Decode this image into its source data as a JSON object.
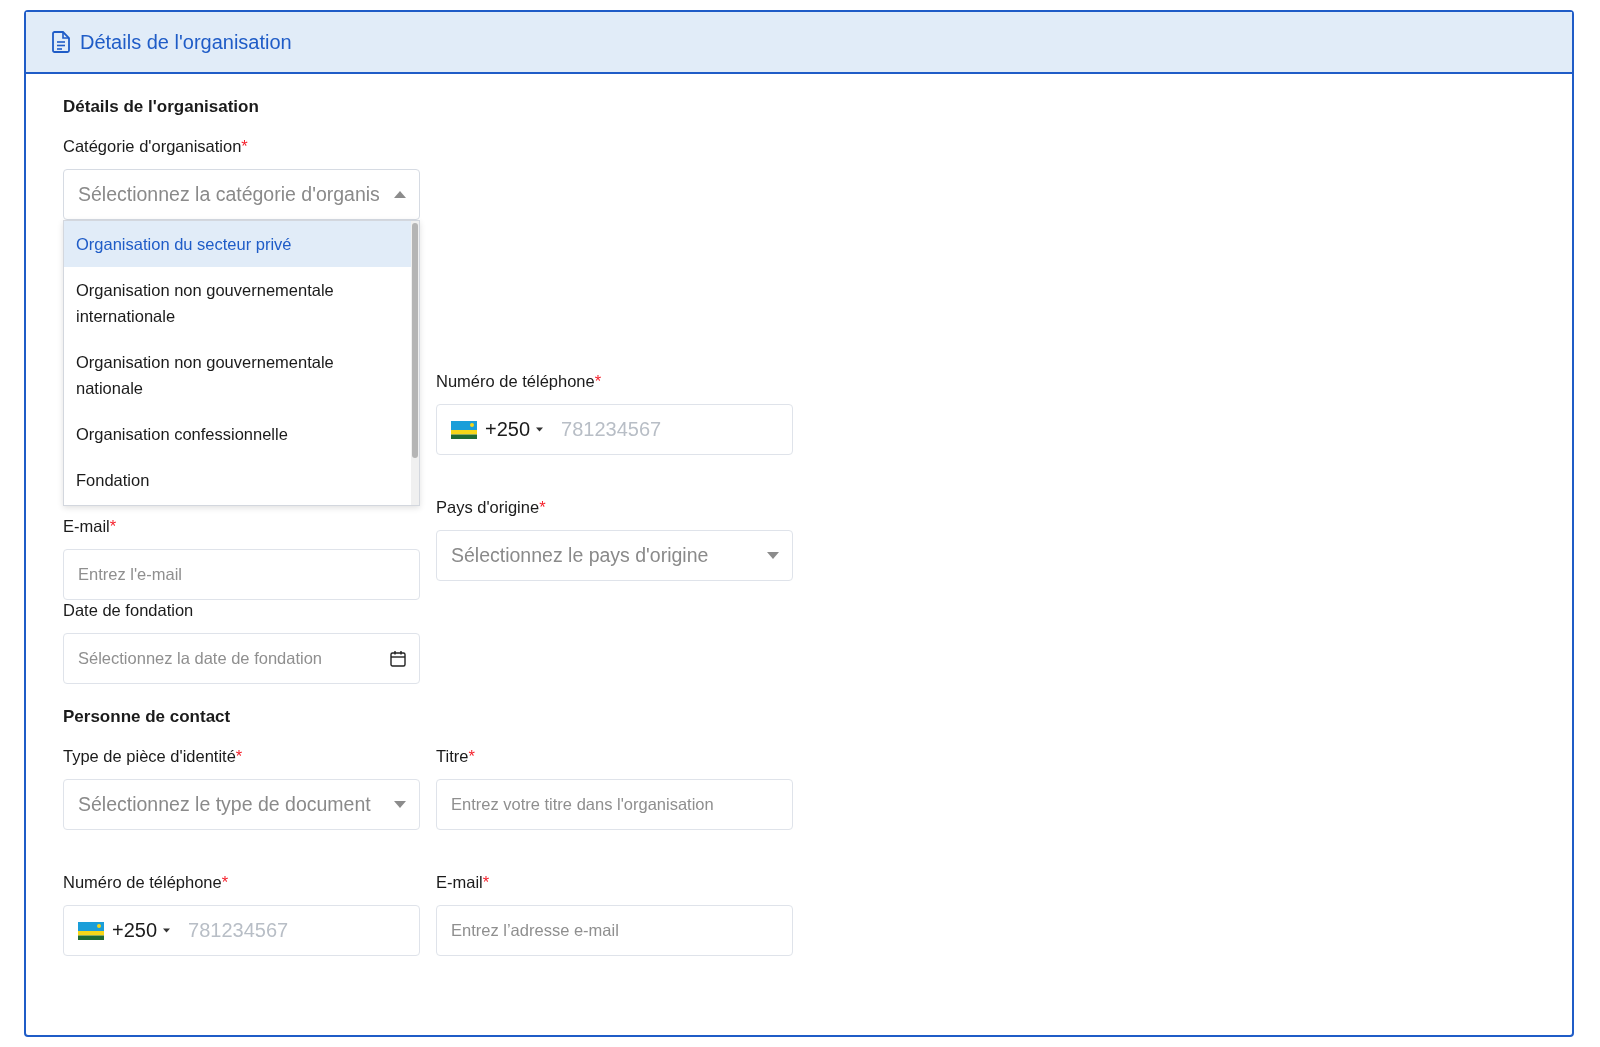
{
  "header": {
    "title": "Détails de l'organisation"
  },
  "sections": [
    {
      "title": "Détails de l'organisation",
      "fields": [
        {
          "kind": "select",
          "label": "Catégorie d'organisation",
          "required_mark": "*",
          "placeholder": "Sélectionnez la catégorie d'organis",
          "open": true,
          "options": [
            {
              "label": "Organisation du secteur privé",
              "selected": true
            },
            {
              "label": "Organisation non gouvernementale internationale",
              "selected": false
            },
            {
              "label": "Organisation non gouvernementale nationale",
              "selected": false
            },
            {
              "label": "Organisation confessionnelle",
              "selected": false
            },
            {
              "label": "Fondation",
              "selected": false
            }
          ]
        },
        {
          "kind": "phone",
          "label": "Numéro de téléphone",
          "required_mark": "*",
          "dial_code": "+250",
          "placeholder": "781234567"
        },
        {
          "kind": "text",
          "label": "E-mail",
          "required_mark": "*",
          "placeholder": "Entrez l'e-mail"
        },
        {
          "kind": "select",
          "label": "Pays d'origine",
          "required_mark": "*",
          "placeholder": "Sélectionnez le pays d'origine",
          "open": false
        },
        {
          "kind": "date",
          "label": "Date de fondation",
          "placeholder": "Sélectionnez la date de fondation"
        }
      ]
    },
    {
      "title": "Personne de contact",
      "fields": [
        {
          "kind": "select",
          "label": "Type de pièce d'identité",
          "required_mark": "*",
          "placeholder": "Sélectionnez le type de document",
          "open": false
        },
        {
          "kind": "text",
          "label": "Titre",
          "required_mark": "*",
          "placeholder": "Entrez votre titre dans l'organisation"
        },
        {
          "kind": "phone",
          "label": "Numéro de téléphone",
          "required_mark": "*",
          "dial_code": "+250",
          "placeholder": "781234567"
        },
        {
          "kind": "text",
          "label": "E-mail",
          "required_mark": "*",
          "placeholder": "Entrez l’adresse e-mail"
        }
      ]
    }
  ]
}
